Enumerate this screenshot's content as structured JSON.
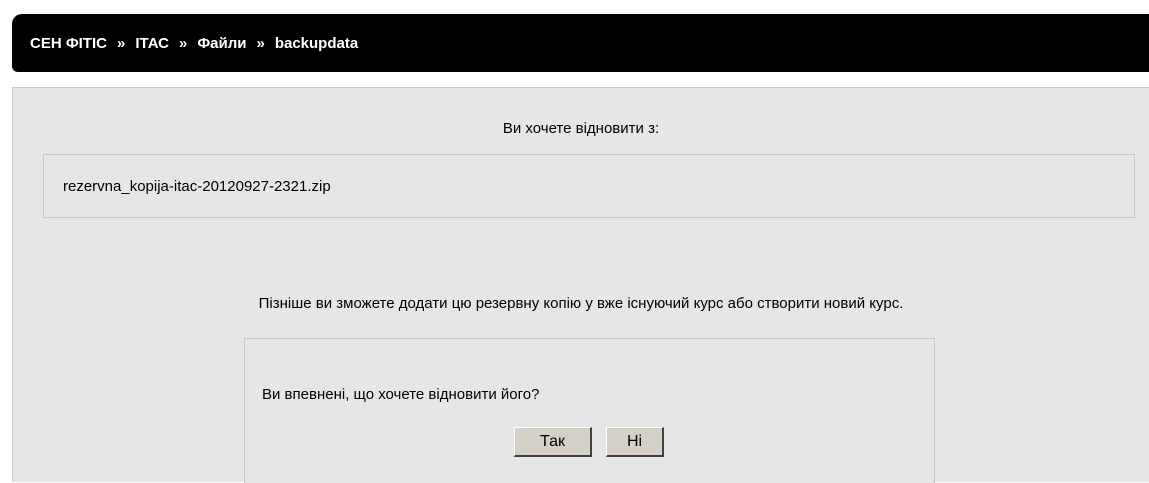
{
  "breadcrumb": {
    "items": [
      "СЕН ФІТІС",
      "ІТАС",
      "Файли",
      "backupdata"
    ],
    "separator": "»"
  },
  "restore": {
    "prompt": "Ви хочете відновити з:",
    "filename": "rezervna_kopija-itac-20120927-2321.zip",
    "info": "Пізніше ви зможете додати цю резервну копію у вже існуючий курс або створити новий курс."
  },
  "confirm": {
    "question": "Ви впевнені, що хочете відновити його?",
    "yes_label": "Так",
    "no_label": "Ні"
  }
}
